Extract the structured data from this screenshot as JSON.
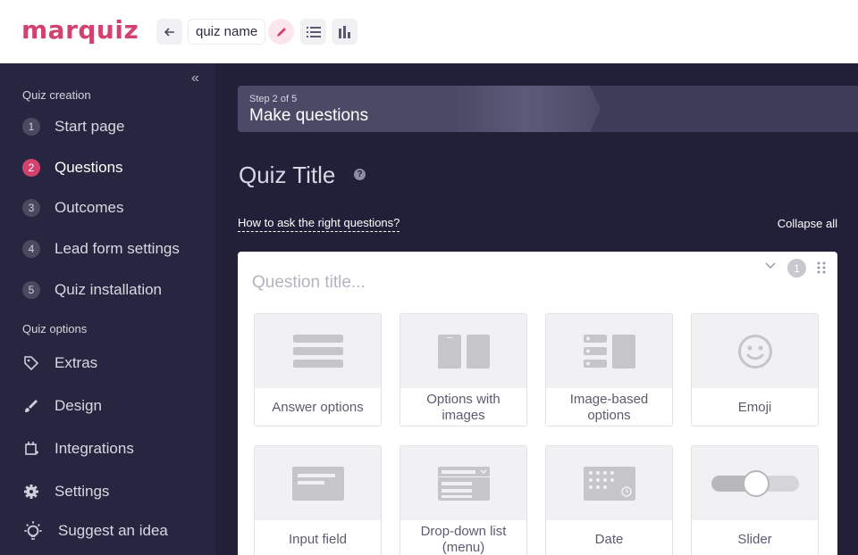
{
  "header": {
    "logo": "marquiz",
    "quiz_name": "quiz name"
  },
  "sidebar": {
    "creation_title": "Quiz creation",
    "steps": [
      {
        "num": "1",
        "label": "Start page"
      },
      {
        "num": "2",
        "label": "Questions",
        "active": true
      },
      {
        "num": "3",
        "label": "Outcomes"
      },
      {
        "num": "4",
        "label": "Lead form settings"
      },
      {
        "num": "5",
        "label": "Quiz installation"
      }
    ],
    "options_title": "Quiz options",
    "options": [
      {
        "label": "Extras",
        "icon": "tag-icon"
      },
      {
        "label": "Design",
        "icon": "brush-icon"
      },
      {
        "label": "Integrations",
        "icon": "integrations-icon"
      },
      {
        "label": "Settings",
        "icon": "gear-icon"
      },
      {
        "label": "Suggest an idea",
        "icon": "lightbulb-icon"
      }
    ]
  },
  "main": {
    "step_counter": "Step 2 of 5",
    "step_title": "Make questions",
    "quiz_title": "Quiz Title",
    "how_link": "How to ask the right questions?",
    "collapse_all": "Collapse all",
    "question_placeholder": "Question title...",
    "question_number": "1",
    "types": [
      {
        "label": "Answer options",
        "icon": "answer-options-icon"
      },
      {
        "label": "Options with images",
        "icon": "options-with-images-icon"
      },
      {
        "label": "Image-based options",
        "icon": "image-based-options-icon"
      },
      {
        "label": "Emoji",
        "icon": "emoji-icon"
      },
      {
        "label": "Input field",
        "icon": "input-field-icon"
      },
      {
        "label": "Drop-down list (menu)",
        "icon": "dropdown-list-icon"
      },
      {
        "label": "Date",
        "icon": "date-icon"
      },
      {
        "label": "Slider",
        "icon": "slider-icon"
      }
    ]
  },
  "colors": {
    "brand": "#d3416f",
    "sidebar_bg": "#262640",
    "main_bg": "#222039"
  }
}
